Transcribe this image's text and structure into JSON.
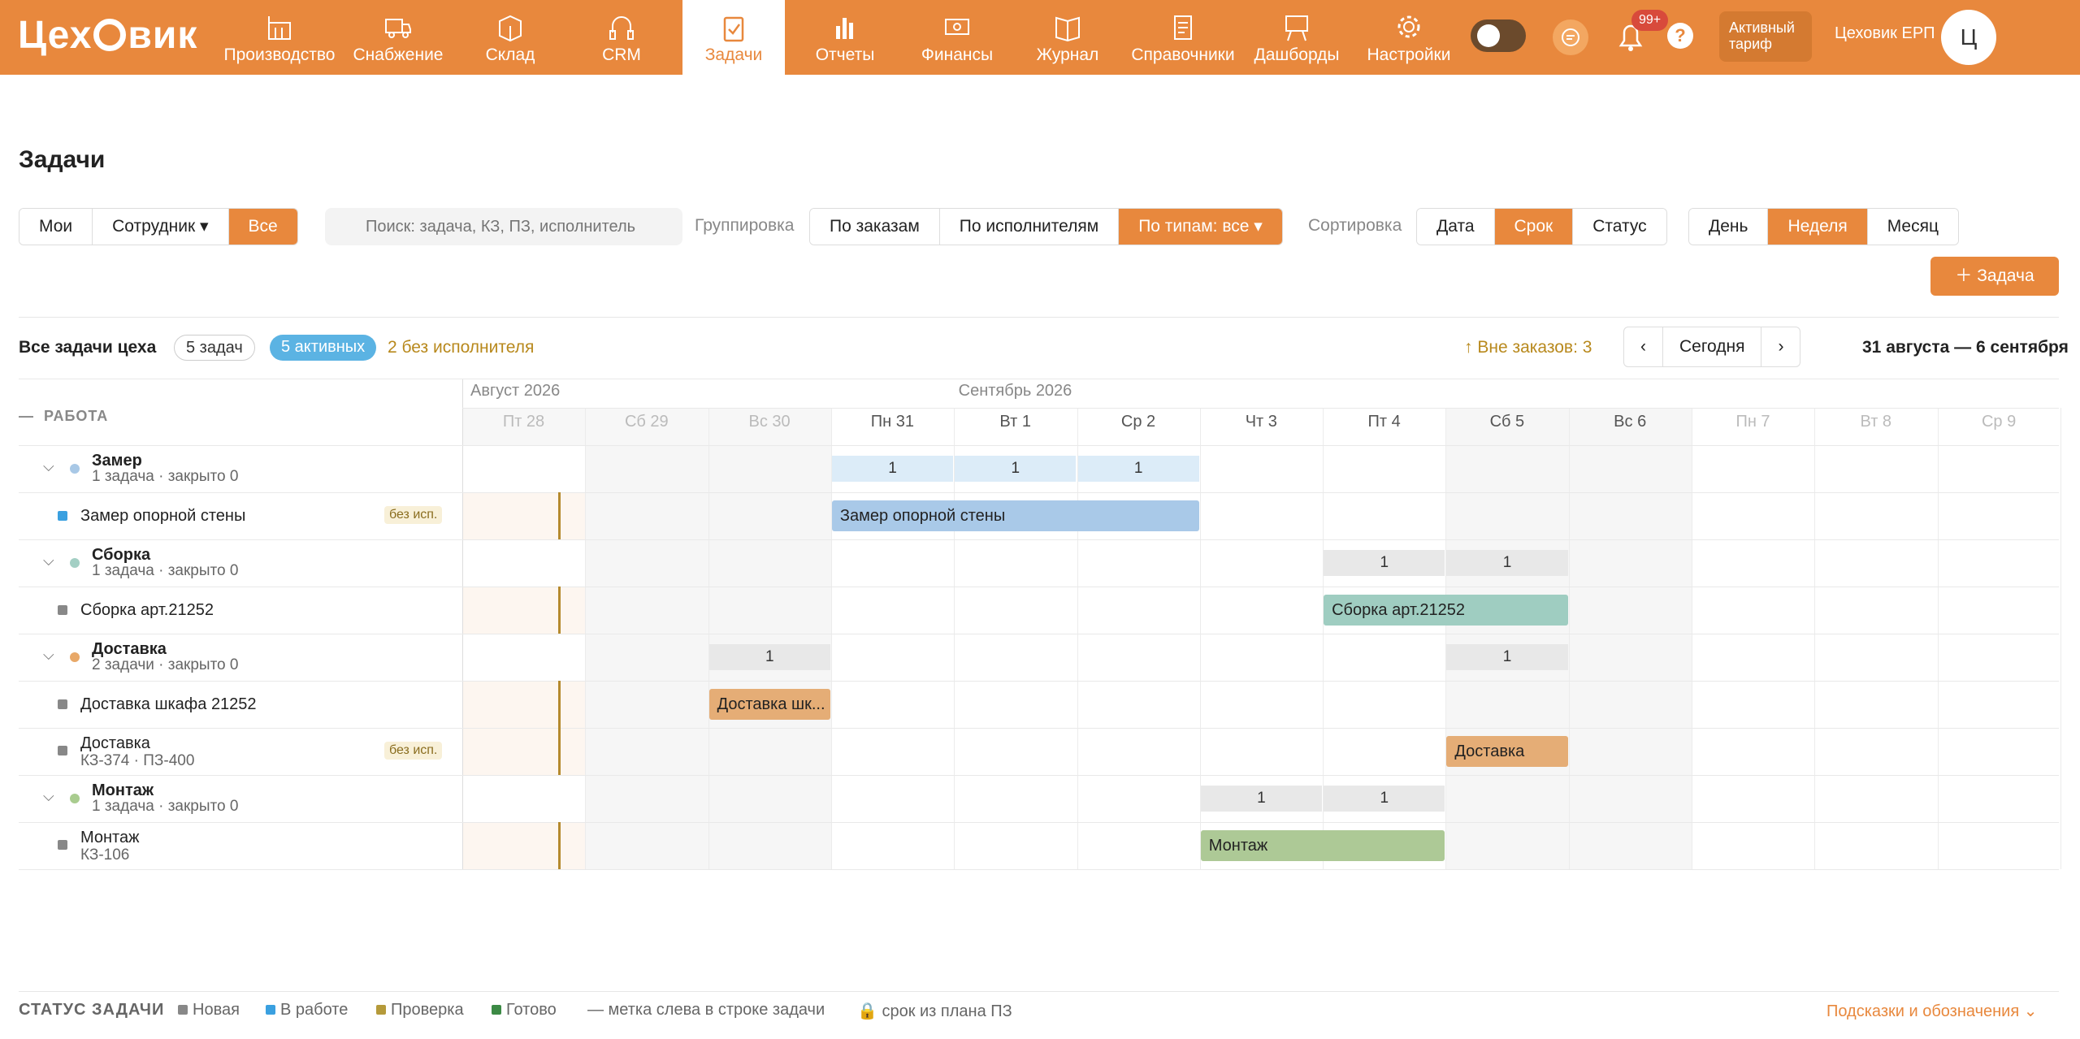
{
  "app": {
    "logo": "Цех",
    "logo2": "вик"
  },
  "nav": [
    {
      "label": "Производство",
      "icon": "factory-icon"
    },
    {
      "label": "Снабжение",
      "icon": "truck-icon"
    },
    {
      "label": "Склад",
      "icon": "box-icon"
    },
    {
      "label": "CRM",
      "icon": "headphones-icon"
    },
    {
      "label": "Задачи",
      "icon": "clipboard-check-icon",
      "active": true
    },
    {
      "label": "Отчеты",
      "icon": "bar-chart-icon"
    },
    {
      "label": "Финансы",
      "icon": "money-icon"
    },
    {
      "label": "Журнал",
      "icon": "book-icon"
    },
    {
      "label": "Справочники",
      "icon": "document-icon"
    },
    {
      "label": "Дашборды",
      "icon": "easel-icon"
    },
    {
      "label": "Настройки",
      "icon": "gear-icon"
    }
  ],
  "header": {
    "notifications": "99+",
    "help": "?",
    "tariff": "Активный тариф",
    "user": "Цеховик ЕРП",
    "avatar": "Ц"
  },
  "page": {
    "title": "Задачи"
  },
  "filters": {
    "who": [
      "Мои",
      "Сотрудник ▾",
      "Все"
    ],
    "search_placeholder": "Поиск: задача, КЗ, ПЗ, исполнитель",
    "grouping_label": "Группировка",
    "grouping": [
      "По заказам",
      "По исполнителям",
      "По типам: все ▾"
    ],
    "sorting_label": "Сортировка",
    "sorting": [
      "Дата",
      "Срок",
      "Статус"
    ],
    "period": [
      "День",
      "Неделя",
      "Месяц"
    ],
    "add_task": "Задача"
  },
  "summary": {
    "title": "Все задачи цеха",
    "total": "5 задач",
    "active": "5 активных",
    "unassigned": "2 без исполнителя",
    "outside_orders": "↑ Вне заказов: 3",
    "today": "Сегодня",
    "range": "31 августа — 6 сентября"
  },
  "calendar": {
    "column_header": "РАБОТА",
    "months": [
      {
        "label": "Август 2026"
      },
      {
        "label": "Сентябрь 2026"
      }
    ],
    "days": [
      "Пт 28",
      "Сб 29",
      "Вс 30",
      "Пн 31",
      "Вт 1",
      "Ср 2",
      "Чт 3",
      "Пт 4",
      "Сб 5",
      "Вс 6",
      "Пн 7",
      "Вт 8",
      "Ср 9"
    ]
  },
  "groups": [
    {
      "name": "Замер",
      "sub": "1 задача · закрыто 0",
      "color": "#a8c8e6",
      "counts": [
        {
          "day": 3,
          "n": "1"
        },
        {
          "day": 4,
          "n": "1"
        },
        {
          "day": 5,
          "n": "1"
        }
      ],
      "tasks": [
        {
          "name": "Замер опорной стены",
          "sub": "",
          "noexec": "без исп.",
          "status_color": "#3aa0e0",
          "bar": {
            "from": 3,
            "to": 5,
            "label": "Замер опорной стены",
            "color": "#a9c9e8"
          }
        }
      ]
    },
    {
      "name": "Сборка",
      "sub": "1 задача · закрыто 0",
      "color": "#a3cfc4",
      "counts": [
        {
          "day": 7,
          "n": "1"
        },
        {
          "day": 8,
          "n": "1"
        }
      ],
      "tasks": [
        {
          "name": "Сборка арт.21252",
          "sub": "",
          "noexec": "",
          "status_color": "#888888",
          "bar": {
            "from": 7,
            "to": 8,
            "label": "Сборка арт.21252",
            "color": "#9fcdc1"
          }
        }
      ]
    },
    {
      "name": "Доставка",
      "sub": "2 задачи · закрыто 0",
      "color": "#e8a868",
      "counts": [
        {
          "day": 2,
          "n": "1"
        },
        {
          "day": 8,
          "n": "1"
        }
      ],
      "tasks": [
        {
          "name": "Доставка шкафа 21252",
          "sub": "",
          "noexec": "",
          "status_color": "#888888",
          "bar": {
            "from": 2,
            "to": 2,
            "label": "Доставка шк...",
            "color": "#e5ad76"
          }
        },
        {
          "name": "Доставка",
          "sub": "КЗ-374 · ПЗ-400",
          "noexec": "без исп.",
          "status_color": "#888888",
          "bar": {
            "from": 8,
            "to": 8,
            "label": "Доставка",
            "color": "#e5ad76"
          }
        }
      ]
    },
    {
      "name": "Монтаж",
      "sub": "1 задача · закрыто 0",
      "color": "#a9cc8f",
      "counts": [
        {
          "day": 6,
          "n": "1"
        },
        {
          "day": 7,
          "n": "1"
        }
      ],
      "tasks": [
        {
          "name": "Монтаж",
          "sub": "КЗ-106",
          "noexec": "",
          "status_color": "#888888",
          "bar": {
            "from": 6,
            "to": 7,
            "label": "Монтаж",
            "color": "#adc996"
          }
        }
      ]
    }
  ],
  "legend": {
    "title": "СТАТУС ЗАДАЧИ",
    "items": [
      {
        "label": "Новая",
        "color": "#888888"
      },
      {
        "label": "В работе",
        "color": "#3aa0e0"
      },
      {
        "label": "Проверка",
        "color": "#b59a3a"
      },
      {
        "label": "Готово",
        "color": "#3c8a45"
      }
    ],
    "note1": "— метка слева в строке задачи",
    "note2": "🔒 срок из плана ПЗ",
    "hints": "Подсказки и обозначения ⌄"
  }
}
